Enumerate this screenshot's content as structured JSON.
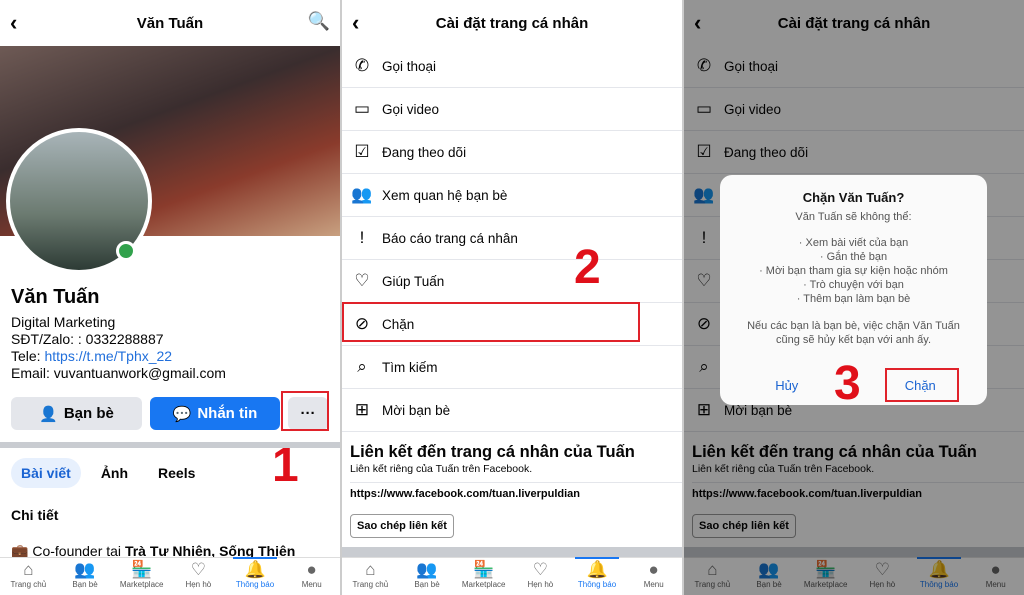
{
  "profile": {
    "title": "Văn Tuấn",
    "name": "Văn Tuấn",
    "bio": "Digital Marketing",
    "phone": "SĐT/Zalo: : 0332288887",
    "tele_label": "Tele: ",
    "tele_link": "https://t.me/Tphx_22",
    "email": "Email: vuvantuanwork@gmail.com",
    "btn_friends": "Bạn bè",
    "btn_message": "Nhắn tin",
    "btn_more": "···",
    "tabs": [
      "Bài viết",
      "Ảnh",
      "Reels"
    ],
    "details_title": "Chi tiết",
    "work_prefix": "Co-founder tai ",
    "work_company": "Trà Tư Nhiên, Sống Thiên"
  },
  "settings": {
    "title": "Cài đặt trang cá nhân",
    "items": [
      {
        "label": "Gọi thoại",
        "icon": "phone-icon",
        "glyph": "✆"
      },
      {
        "label": "Gọi video",
        "icon": "video-icon",
        "glyph": "▭"
      },
      {
        "label": "Đang theo dõi",
        "icon": "following-icon",
        "glyph": "☑"
      },
      {
        "label": "Xem quan hệ bạn bè",
        "icon": "friends-icon",
        "glyph": "👥"
      },
      {
        "label": "Báo cáo trang cá nhân",
        "icon": "report-icon",
        "glyph": "!"
      },
      {
        "label": "Giúp Tuấn",
        "icon": "heart-icon",
        "glyph": "♡"
      },
      {
        "label": "Chặn",
        "icon": "block-user-icon",
        "glyph": "⊘"
      },
      {
        "label": "Tìm kiếm",
        "icon": "search-icon",
        "glyph": "⌕"
      },
      {
        "label": "Mời bạn bè",
        "icon": "invite-icon",
        "glyph": "⊞"
      }
    ],
    "link_title": "Liên kết đến trang cá nhân của Tuấn",
    "link_sub": "Liên kết riêng của Tuấn trên Facebook.",
    "link_url": "https://www.facebook.com/tuan.liverpuldian",
    "copy_btn": "Sao chép liên kết"
  },
  "dialog": {
    "title": "Chặn Văn Tuấn?",
    "intro": "Văn Tuấn sẽ không thể:",
    "bullets": [
      "· Xem bài viết của bạn",
      "· Gắn thẻ bạn",
      "· Mời bạn tham gia sự kiện hoặc nhóm",
      "· Trò chuyện với bạn",
      "· Thêm bạn làm bạn bè"
    ],
    "note": "Nếu các bạn là bạn bè, việc chặn Văn Tuấn cũng sẽ hủy kết bạn với anh ấy.",
    "cancel": "Hủy",
    "confirm": "Chặn"
  },
  "nav": [
    {
      "label": "Trang chủ",
      "glyph": "⌂",
      "icon": "home-icon"
    },
    {
      "label": "Bạn bè",
      "glyph": "👥",
      "icon": "friends-icon"
    },
    {
      "label": "Marketplace",
      "glyph": "🏪",
      "icon": "marketplace-icon"
    },
    {
      "label": "Hẹn hò",
      "glyph": "♡",
      "icon": "dating-icon"
    },
    {
      "label": "Thông báo",
      "glyph": "🔔",
      "icon": "bell-icon",
      "active": true
    },
    {
      "label": "Menu",
      "glyph": "●",
      "icon": "avatar-menu-icon"
    }
  ],
  "steps": [
    "1",
    "2",
    "3"
  ],
  "colors": {
    "accent": "#1877f2",
    "annotation": "#e0222a"
  }
}
